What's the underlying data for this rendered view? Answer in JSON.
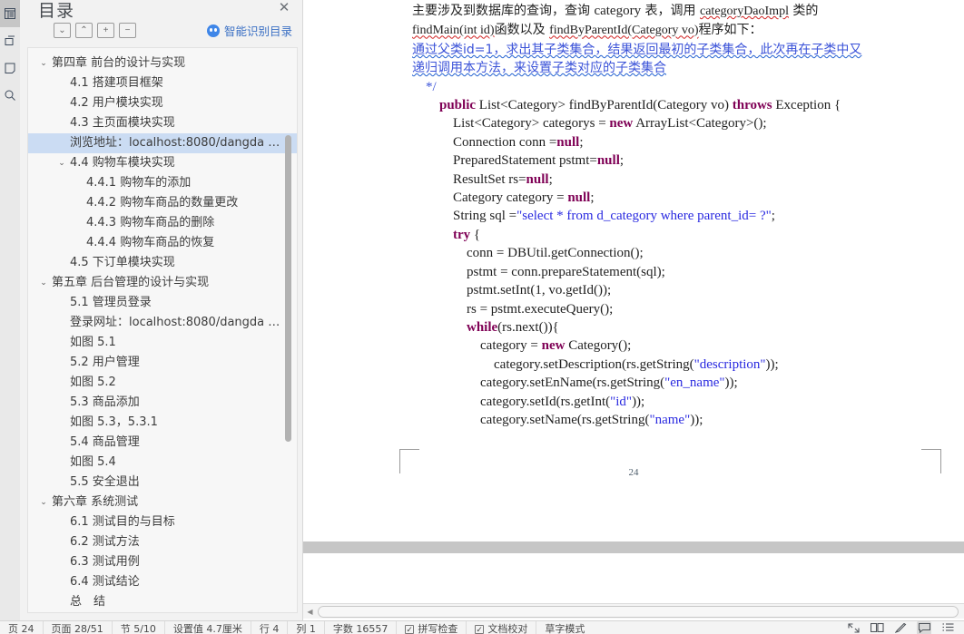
{
  "rail": {
    "items": [
      {
        "name": "document-outline-icon",
        "active": true
      },
      {
        "name": "bookmark-icon",
        "active": false
      },
      {
        "name": "page-thumbnail-icon",
        "active": false
      },
      {
        "name": "search-icon",
        "active": false
      }
    ]
  },
  "toc": {
    "title": "目录",
    "close_label": "✕",
    "toolbar": {
      "collapse_down_label": "⌄",
      "collapse_up_label": "⌃",
      "expand_label": "+",
      "collapse_label": "−"
    },
    "smart_toc_label": "智能识别目录",
    "accent_color": "#3b70c4",
    "selection_color": "#cbdcf3",
    "items": [
      {
        "label": "第四章  前台的设计与实现",
        "level": 1,
        "caret": "⌄",
        "selected": false
      },
      {
        "label": "4.1  搭建项目框架",
        "level": 2,
        "caret": "",
        "selected": false
      },
      {
        "label": "4.2  用户模块实现",
        "level": 2,
        "caret": "",
        "selected": false
      },
      {
        "label": "4.3  主页面模块实现",
        "level": 2,
        "caret": "",
        "selected": false
      },
      {
        "label": "浏览地址：localhost:8080/dangda …",
        "level": 2,
        "caret": "",
        "selected": true
      },
      {
        "label": "4.4  购物车模块实现",
        "level": 2,
        "caret": "⌄",
        "selected": false
      },
      {
        "label": "4.4.1  购物车的添加",
        "level": 3,
        "caret": "",
        "selected": false
      },
      {
        "label": "4.4.2  购物车商品的数量更改",
        "level": 3,
        "caret": "",
        "selected": false
      },
      {
        "label": "4.4.3  购物车商品的删除",
        "level": 3,
        "caret": "",
        "selected": false
      },
      {
        "label": "4.4.4  购物车商品的恢复",
        "level": 3,
        "caret": "",
        "selected": false
      },
      {
        "label": "4.5  下订单模块实现",
        "level": 2,
        "caret": "",
        "selected": false
      },
      {
        "label": "第五章  后台管理的设计与实现",
        "level": 1,
        "caret": "⌄",
        "selected": false
      },
      {
        "label": "5.1 管理员登录",
        "level": 2,
        "caret": "",
        "selected": false
      },
      {
        "label": "登录网址：localhost:8080/dangda …",
        "level": 2,
        "caret": "",
        "selected": false
      },
      {
        "label": "如图 5.1",
        "level": 2,
        "caret": "",
        "selected": false
      },
      {
        "label": "5.2  用户管理",
        "level": 2,
        "caret": "",
        "selected": false
      },
      {
        "label": "如图 5.2",
        "level": 2,
        "caret": "",
        "selected": false
      },
      {
        "label": "5.3  商品添加",
        "level": 2,
        "caret": "",
        "selected": false
      },
      {
        "label": "如图 5.3，5.3.1",
        "level": 2,
        "caret": "",
        "selected": false
      },
      {
        "label": "5.4  商品管理",
        "level": 2,
        "caret": "",
        "selected": false
      },
      {
        "label": "如图 5.4",
        "level": 2,
        "caret": "",
        "selected": false
      },
      {
        "label": "5.5  安全退出",
        "level": 2,
        "caret": "",
        "selected": false
      },
      {
        "label": "第六章  系统测试",
        "level": 1,
        "caret": "⌄",
        "selected": false
      },
      {
        "label": "6.1  测试目的与目标",
        "level": 2,
        "caret": "",
        "selected": false
      },
      {
        "label": "6.2  测试方法",
        "level": 2,
        "caret": "",
        "selected": false
      },
      {
        "label": "6.3  测试用例",
        "level": 2,
        "caret": "",
        "selected": false
      },
      {
        "label": "6.4  测试结论",
        "level": 2,
        "caret": "",
        "selected": false
      },
      {
        "label": "总　结",
        "level": 2,
        "caret": "",
        "selected": false
      }
    ]
  },
  "document": {
    "page_number": "24",
    "paragraph": {
      "line1_a": "主要涉及到数据库的查询，查询 ",
      "line1_b": "category",
      "line1_c": " 表，调用 ",
      "line1_d": "categoryDaoImpl",
      "line1_e": " 类的",
      "line2_a": "findMain(int id)",
      "line2_b": "函数以及 ",
      "line2_c": "findByParentId(Category vo)",
      "line2_d": "程序如下：",
      "line3": "通过父类id=1，求出其子类集合，结果返回最初的子类集合，此次再在子类中又",
      "line4": "递归调用本方法，来设置子类对应的子类集合",
      "line5": "    */"
    },
    "code_lines": [
      "        public List<Category> findByParentId(Category vo) throws Exception {",
      "            List<Category> categorys = new ArrayList<Category>();",
      "            Connection conn =null;",
      "            PreparedStatement pstmt=null;",
      "            ResultSet rs=null;",
      "            Category category = null;",
      "            String sql =\"select * from d_category where parent_id= ?\";",
      "            try {",
      "                conn = DBUtil.getConnection();",
      "                pstmt = conn.prepareStatement(sql);",
      "                pstmt.setInt(1, vo.getId());",
      "                rs = pstmt.executeQuery();",
      "                while(rs.next()){",
      "                    category = new Category();",
      "                        category.setDescription(rs.getString(\"description\"));",
      "                    category.setEnName(rs.getString(\"en_name\"));",
      "                    category.setId(rs.getInt(\"id\"));",
      "                    category.setName(rs.getString(\"name\"));"
    ]
  },
  "scrollbars": {
    "hscroll_left_arrow": "◀"
  },
  "statusbar": {
    "page_indicator": "页 24",
    "page_of": "页面  28/51",
    "section": "节  5/10",
    "position": "设置值  4.7厘米",
    "row": "行  4",
    "column": "列  1",
    "word_count": "字数  16557",
    "spellcheck": "拼写检查",
    "proofread": "文档校对",
    "typing_mode": "草字模式",
    "icons": [
      {
        "name": "fullscreen-icon"
      },
      {
        "name": "two-page-view-icon"
      },
      {
        "name": "edit-pen-icon"
      },
      {
        "name": "comment-icon",
        "active": true
      },
      {
        "name": "list-view-icon"
      }
    ]
  }
}
